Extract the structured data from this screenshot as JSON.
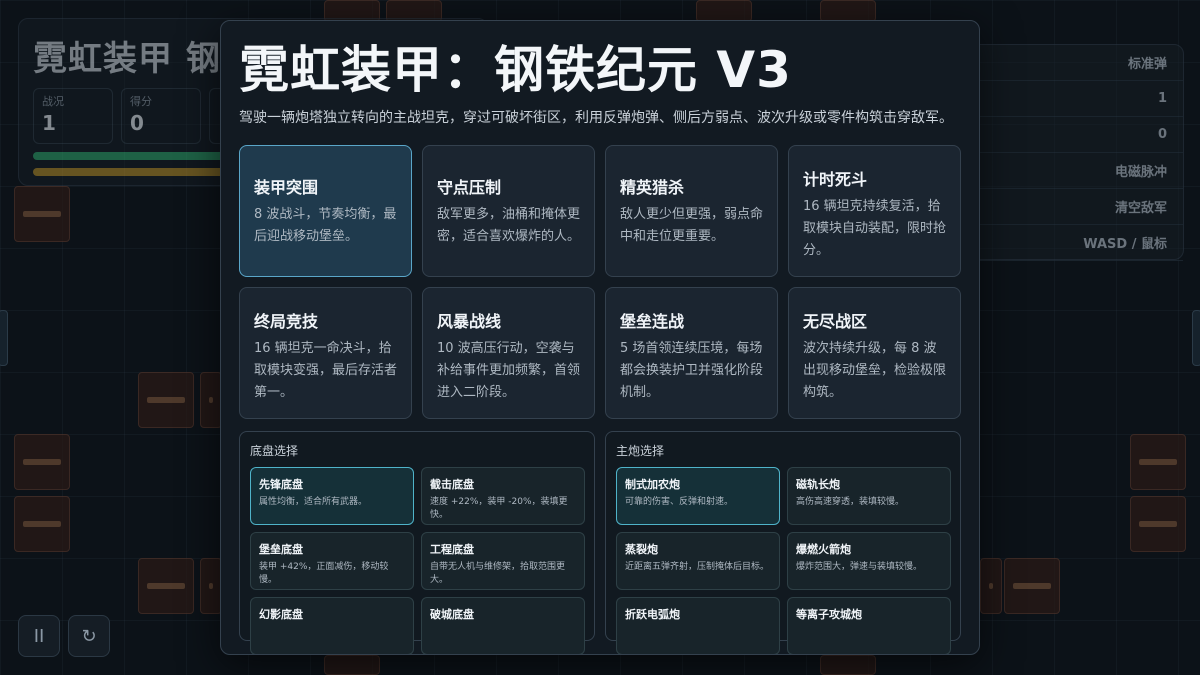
{
  "background": {
    "hud": {
      "title": "霓虹装甲 钢",
      "stats": [
        {
          "label": "战况",
          "value": "1"
        },
        {
          "label": "得分",
          "value": "0"
        }
      ]
    },
    "side_panel": {
      "rows": [
        "标准弹",
        "1",
        "0",
        "电磁脉冲",
        "清空敌军",
        "WASD / 鼠标"
      ]
    },
    "controls": {
      "pause_icon": "pause-icon",
      "restart_icon": "restart-icon"
    }
  },
  "modal": {
    "title": "霓虹装甲：钢铁纪元 V3",
    "description": "驾驶一辆炮塔独立转向的主战坦克，穿过可破坏街区，利用反弹炮弹、侧后方弱点、波次升级或零件构筑击穿敌军。",
    "modes": [
      {
        "name": "装甲突围",
        "desc": "8 波战斗，节奏均衡，最后迎战移动堡垒。",
        "selected": true
      },
      {
        "name": "守点压制",
        "desc": "敌军更多，油桶和掩体更密，适合喜欢爆炸的人。",
        "selected": false
      },
      {
        "name": "精英猎杀",
        "desc": "敌人更少但更强，弱点命中和走位更重要。",
        "selected": false
      },
      {
        "name": "计时死斗",
        "desc": "16 辆坦克持续复活，拾取模块自动装配，限时抢分。",
        "selected": false
      },
      {
        "name": "终局竞技",
        "desc": "16 辆坦克一命决斗，拾取模块变强，最后存活者第一。",
        "selected": false
      },
      {
        "name": "风暴战线",
        "desc": "10 波高压行动，空袭与补给事件更加频繁，首领进入二阶段。",
        "selected": false
      },
      {
        "name": "堡垒连战",
        "desc": "5 场首领连续压境，每场都会换装护卫并强化阶段机制。",
        "selected": false
      },
      {
        "name": "无尽战区",
        "desc": "波次持续升级，每 8 波出现移动堡垒，检验极限构筑。",
        "selected": false
      }
    ],
    "chassis": {
      "heading": "底盘选择",
      "options": [
        {
          "name": "先锋底盘",
          "desc": "属性均衡，适合所有武器。",
          "selected": true
        },
        {
          "name": "截击底盘",
          "desc": "速度 +22%，装甲 -20%，装填更快。",
          "selected": false
        },
        {
          "name": "堡垒底盘",
          "desc": "装甲 +42%，正面减伤，移动较慢。",
          "selected": false
        },
        {
          "name": "工程底盘",
          "desc": "自带无人机与维修架，拾取范围更大。",
          "selected": false
        },
        {
          "name": "幻影底盘",
          "desc": "",
          "selected": false
        },
        {
          "name": "破城底盘",
          "desc": "",
          "selected": false
        }
      ]
    },
    "cannon": {
      "heading": "主炮选择",
      "options": [
        {
          "name": "制式加农炮",
          "desc": "可靠的伤害、反弹和射速。",
          "selected": true
        },
        {
          "name": "磁轨长炮",
          "desc": "高伤高速穿透，装填较慢。",
          "selected": false
        },
        {
          "name": "蒸裂炮",
          "desc": "近距离五弹齐射，压制掩体后目标。",
          "selected": false
        },
        {
          "name": "爆燃火箭炮",
          "desc": "爆炸范围大，弹速与装填较慢。",
          "selected": false
        },
        {
          "name": "折跃电弧炮",
          "desc": "",
          "selected": false
        },
        {
          "name": "等离子攻城炮",
          "desc": "",
          "selected": false
        }
      ]
    }
  }
}
